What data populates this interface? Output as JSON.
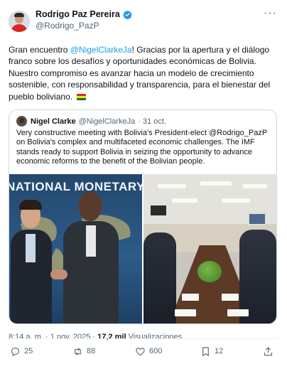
{
  "author": {
    "display_name": "Rodrigo Paz Pereira",
    "handle": "@Rodrigo_PazP"
  },
  "tweet": {
    "text_prefix": "Gran encuentro ",
    "mention": "@NigelClarkeJa",
    "text_suffix": "! Gracias por la apertura y el diálogo franco sobre los desafíos y oportunidades económicas de Bolivia. Nuestro compromiso es avanzar hacia un modelo de crecimiento sostenible, con responsabilidad y transparencia, para el bienestar del pueblo boliviano. ",
    "flag_colors": [
      "#d52b1e",
      "#f9e300",
      "#007934"
    ]
  },
  "quote": {
    "name": "Nigel Clarke",
    "handle": "@NigelClarkeJa",
    "date": "· 31 oct.",
    "text": "Very constructive meeting with Bolivia's President-elect @Rodrigo_PazP on Bolivia's complex and multifaceted economic challenges. The IMF stands ready to support Bolivia in seizing the opportunity to advance economic reforms to the benefit of the Bolivian people.",
    "banner_text": "NATIONAL MONETARY F"
  },
  "meta": {
    "time_date": "8:14 a. m. · 1 nov. 2025 · ",
    "views_count": "17,2 mil",
    "views_label": " Visualizaciones"
  },
  "actions": {
    "replies": "25",
    "reposts": "88",
    "likes": "600",
    "bookmarks": "12"
  },
  "colors": {
    "accent": "#1d9bf0",
    "secondary_text": "#536471"
  }
}
